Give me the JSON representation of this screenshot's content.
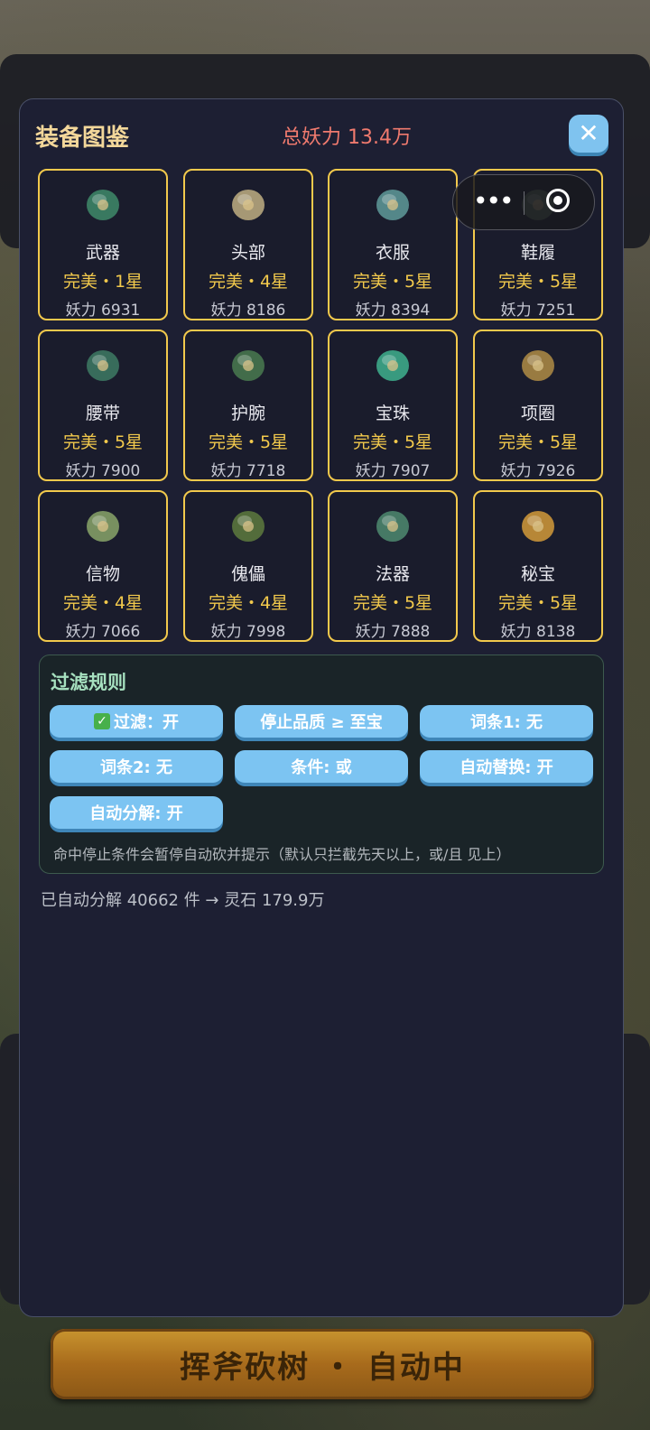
{
  "modal": {
    "title": "装备图鉴",
    "total_power": "总妖力 13.4万",
    "close_label": "✕"
  },
  "equipment": [
    {
      "name": "武器",
      "quality": "完美・1星",
      "power": "妖力 6931",
      "icon": "axe-icon",
      "color": "#3f8a6a"
    },
    {
      "name": "头部",
      "quality": "完美・4星",
      "power": "妖力 8186",
      "icon": "crown-icon",
      "color": "#bfae82"
    },
    {
      "name": "衣服",
      "quality": "完美・5星",
      "power": "妖力 8394",
      "icon": "armor-icon",
      "color": "#5f9a9a"
    },
    {
      "name": "鞋履",
      "quality": "完美・5星",
      "power": "妖力 7251",
      "icon": "boots-icon",
      "color": "#6e8a66"
    },
    {
      "name": "腰带",
      "quality": "完美・5星",
      "power": "妖力 7900",
      "icon": "belt-icon",
      "color": "#3e7a64"
    },
    {
      "name": "护腕",
      "quality": "完美・5星",
      "power": "妖力 7718",
      "icon": "bracers-icon",
      "color": "#4a7a50"
    },
    {
      "name": "宝珠",
      "quality": "完美・5星",
      "power": "妖力 7907",
      "icon": "orb-icon",
      "color": "#3fb08e"
    },
    {
      "name": "项圈",
      "quality": "完美・5星",
      "power": "妖力 7926",
      "icon": "collar-icon",
      "color": "#b08c45"
    },
    {
      "name": "信物",
      "quality": "完美・4星",
      "power": "妖力 7066",
      "icon": "pendant-icon",
      "color": "#8aa46a"
    },
    {
      "name": "傀儡",
      "quality": "完美・4星",
      "power": "妖力 7998",
      "icon": "puppet-icon",
      "color": "#5e7a3e"
    },
    {
      "name": "法器",
      "quality": "完美・5星",
      "power": "妖力 7888",
      "icon": "staff-icon",
      "color": "#4f8a70"
    },
    {
      "name": "秘宝",
      "quality": "完美・5星",
      "power": "妖力 8138",
      "icon": "treasure-icon",
      "color": "#d49a3a"
    }
  ],
  "filter": {
    "title": "过滤规则",
    "buttons": [
      {
        "label": "过滤：开",
        "checked": true
      },
      {
        "label": "停止品质 ≥ 至宝"
      },
      {
        "label": "词条1: 无"
      },
      {
        "label": "词条2: 无"
      },
      {
        "label": "条件: 或"
      },
      {
        "label": "自动替换: 开"
      },
      {
        "label": "自动分解: 开"
      }
    ],
    "hint": "命中停止条件会暂停自动砍并提示（默认只拦截先天以上，或/且 见上）"
  },
  "decompose_stats": "已自动分解 40662 件 → 灵石 179.9万",
  "bottom_bar": {
    "label": "挥斧砍树 ・ 自动中"
  },
  "capsule": {
    "more_icon": "more-icon",
    "close_icon": "target-icon"
  }
}
